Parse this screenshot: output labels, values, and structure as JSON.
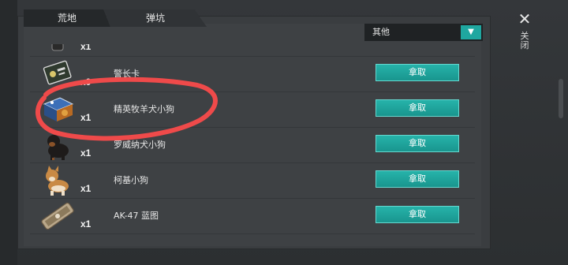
{
  "tabs": [
    {
      "label": "荒地"
    },
    {
      "label": "弹坑"
    }
  ],
  "filter": {
    "selected": "其他",
    "arrow": "▼"
  },
  "close": {
    "icon": "✕",
    "label": "关闭"
  },
  "take_label": "拿取",
  "items": [
    {
      "name": "",
      "qty": "x1",
      "icon": "partial-item-icon"
    },
    {
      "name": "警长卡",
      "qty": "x0",
      "icon": "sheriff-card-icon"
    },
    {
      "name": "精英牧羊犬小狗",
      "qty": "x1",
      "icon": "elite-shepherd-puppy-icon"
    },
    {
      "name": "罗威纳犬小狗",
      "qty": "x1",
      "icon": "rottweiler-puppy-icon"
    },
    {
      "name": "柯基小狗",
      "qty": "x1",
      "icon": "corgi-puppy-icon"
    },
    {
      "name": "AK-47 蓝图",
      "qty": "x1",
      "icon": "ak47-blueprint-icon"
    }
  ],
  "colors": {
    "accent": "#1fa7a0",
    "highlight_ring": "#ef4a4a"
  }
}
